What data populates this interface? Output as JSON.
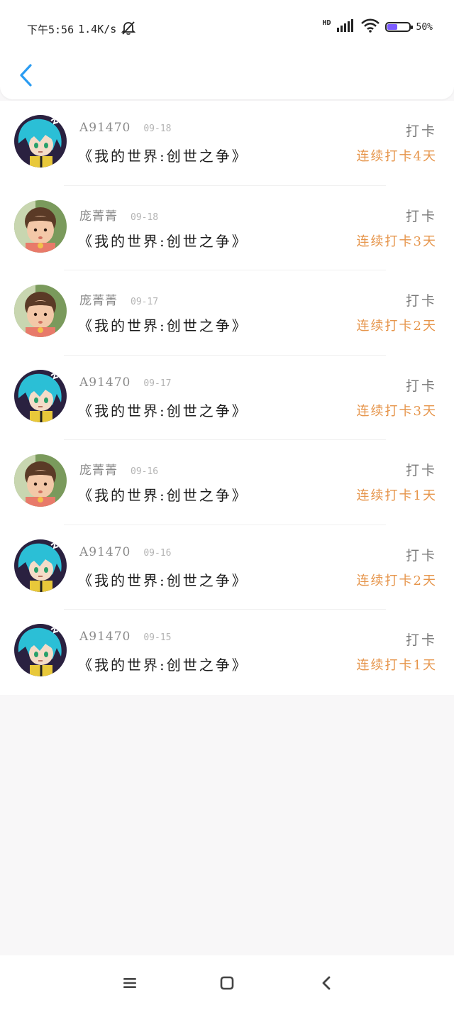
{
  "status_bar": {
    "time": "下午5:56",
    "speed": "1.4K/s",
    "network": "HD",
    "battery": "50%",
    "battery_level": 0.5
  },
  "header": {
    "back_icon": "chevron-left-icon"
  },
  "colors": {
    "accent": "#2a9cf2",
    "streak": "#e6954b"
  },
  "records": [
    {
      "user": "A91470",
      "date": "09-18",
      "title": "《我的世界:创世之争》",
      "type": "打卡",
      "streak": "连续打卡4天",
      "avatar": "anime"
    },
    {
      "user": "庞菁菁",
      "date": "09-18",
      "title": "《我的世界:创世之争》",
      "type": "打卡",
      "streak": "连续打卡3天",
      "avatar": "child"
    },
    {
      "user": "庞菁菁",
      "date": "09-17",
      "title": "《我的世界:创世之争》",
      "type": "打卡",
      "streak": "连续打卡2天",
      "avatar": "child"
    },
    {
      "user": "A91470",
      "date": "09-17",
      "title": "《我的世界:创世之争》",
      "type": "打卡",
      "streak": "连续打卡3天",
      "avatar": "anime"
    },
    {
      "user": "庞菁菁",
      "date": "09-16",
      "title": "《我的世界:创世之争》",
      "type": "打卡",
      "streak": "连续打卡1天",
      "avatar": "child"
    },
    {
      "user": "A91470",
      "date": "09-16",
      "title": "《我的世界:创世之争》",
      "type": "打卡",
      "streak": "连续打卡2天",
      "avatar": "anime"
    },
    {
      "user": "A91470",
      "date": "09-15",
      "title": "《我的世界:创世之争》",
      "type": "打卡",
      "streak": "连续打卡1天",
      "avatar": "anime"
    }
  ],
  "nav": {
    "menu_icon": "menu-icon",
    "home_icon": "home-icon",
    "back_icon": "back-icon"
  }
}
